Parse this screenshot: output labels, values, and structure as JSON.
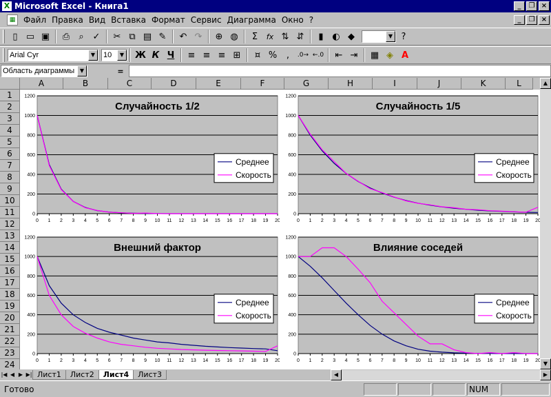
{
  "window": {
    "title": "Microsoft Excel - Книга1",
    "app_icon": "X"
  },
  "menu": {
    "items": [
      "Файл",
      "Правка",
      "Вид",
      "Вставка",
      "Формат",
      "Сервис",
      "Диаграмма",
      "Окно",
      "?"
    ]
  },
  "toolbar": {
    "font_name": "Arial Cyr",
    "font_size": "10",
    "bold": "Ж",
    "italic": "К",
    "underline": "Ч",
    "percent": "%",
    "comma": ",",
    "sum": "Σ",
    "fx": "fx"
  },
  "formula_bar": {
    "name_box": "Область диаграммы",
    "eq": "="
  },
  "columns": [
    "A",
    "B",
    "C",
    "D",
    "E",
    "F",
    "G",
    "H",
    "I",
    "J",
    "K",
    "L"
  ],
  "rows": [
    "1",
    "2",
    "3",
    "4",
    "5",
    "6",
    "7",
    "8",
    "9",
    "10",
    "11",
    "12",
    "13",
    "14",
    "15",
    "16",
    "17",
    "18",
    "19",
    "20",
    "21",
    "22",
    "23",
    "24"
  ],
  "tabs": [
    "Лист1",
    "Лист2",
    "Лист4",
    "Лист3"
  ],
  "active_tab": "Лист4",
  "status": {
    "text": "Готово",
    "num": "NUM"
  },
  "colors": {
    "series_avg": "#000080",
    "series_speed": "#ff00ff",
    "plot_bg": "#c0c0c0"
  },
  "chart_data": [
    {
      "type": "line",
      "title": "Случайность 1/2",
      "x": [
        0,
        1,
        2,
        3,
        4,
        5,
        6,
        7,
        8,
        9,
        10,
        11,
        12,
        13,
        14,
        15,
        16,
        17,
        18,
        19,
        20
      ],
      "ylim": [
        0,
        1200
      ],
      "yticks": [
        0,
        200,
        400,
        600,
        800,
        1000,
        1200
      ],
      "legend": "right",
      "series": [
        {
          "name": "Среднее",
          "values": [
            1000,
            500,
            250,
            125,
            63,
            31,
            16,
            8,
            4,
            2,
            1,
            0,
            0,
            0,
            0,
            0,
            0,
            0,
            0,
            0,
            0
          ]
        },
        {
          "name": "Скорость",
          "values": [
            1000,
            490,
            245,
            125,
            60,
            32,
            15,
            9,
            3,
            6,
            1,
            0,
            0,
            0,
            0,
            0,
            0,
            0,
            0,
            0,
            0
          ]
        }
      ]
    },
    {
      "type": "line",
      "title": "Случайность 1/5",
      "x": [
        0,
        1,
        2,
        3,
        4,
        5,
        6,
        7,
        8,
        9,
        10,
        11,
        12,
        13,
        14,
        15,
        16,
        17,
        18,
        19,
        20
      ],
      "ylim": [
        0,
        1200
      ],
      "yticks": [
        0,
        200,
        400,
        600,
        800,
        1000,
        1200
      ],
      "legend": "right",
      "series": [
        {
          "name": "Среднее",
          "values": [
            1000,
            800,
            640,
            512,
            410,
            328,
            262,
            210,
            168,
            134,
            107,
            86,
            69,
            55,
            44,
            35,
            28,
            23,
            18,
            14,
            12
          ]
        },
        {
          "name": "Скорость",
          "values": [
            1000,
            810,
            650,
            530,
            410,
            330,
            255,
            215,
            170,
            130,
            105,
            90,
            70,
            60,
            45,
            40,
            30,
            25,
            20,
            15,
            65
          ]
        }
      ]
    },
    {
      "type": "line",
      "title": "Внешний фактор",
      "x": [
        0,
        1,
        2,
        3,
        4,
        5,
        6,
        7,
        8,
        9,
        10,
        11,
        12,
        13,
        14,
        15,
        16,
        17,
        18,
        19,
        20
      ],
      "ylim": [
        0,
        1200
      ],
      "yticks": [
        0,
        200,
        400,
        600,
        800,
        1000,
        1200
      ],
      "legend": "right",
      "series": [
        {
          "name": "Среднее",
          "values": [
            1000,
            700,
            520,
            400,
            320,
            260,
            220,
            190,
            160,
            140,
            120,
            110,
            95,
            85,
            75,
            68,
            62,
            57,
            52,
            48,
            30
          ]
        },
        {
          "name": "Скорость",
          "values": [
            1000,
            600,
            400,
            280,
            210,
            160,
            120,
            95,
            80,
            65,
            55,
            48,
            42,
            38,
            35,
            32,
            30,
            28,
            25,
            22,
            80
          ]
        }
      ]
    },
    {
      "type": "line",
      "title": "Влияние соседей",
      "x": [
        0,
        1,
        2,
        3,
        4,
        5,
        6,
        7,
        8,
        9,
        10,
        11,
        12,
        13,
        14,
        15,
        16,
        17,
        18,
        19,
        20
      ],
      "ylim": [
        0,
        1200
      ],
      "yticks": [
        0,
        200,
        400,
        600,
        800,
        1000,
        1200
      ],
      "legend": "right",
      "series": [
        {
          "name": "Среднее",
          "values": [
            1000,
            900,
            780,
            650,
            520,
            400,
            290,
            200,
            130,
            80,
            45,
            25,
            15,
            8,
            4,
            2,
            1,
            0,
            0,
            0,
            0
          ]
        },
        {
          "name": "Скорость",
          "values": [
            1000,
            1000,
            1090,
            1090,
            1000,
            870,
            730,
            540,
            420,
            300,
            180,
            100,
            100,
            40,
            10,
            0,
            10,
            0,
            10,
            0,
            0
          ]
        }
      ]
    }
  ]
}
